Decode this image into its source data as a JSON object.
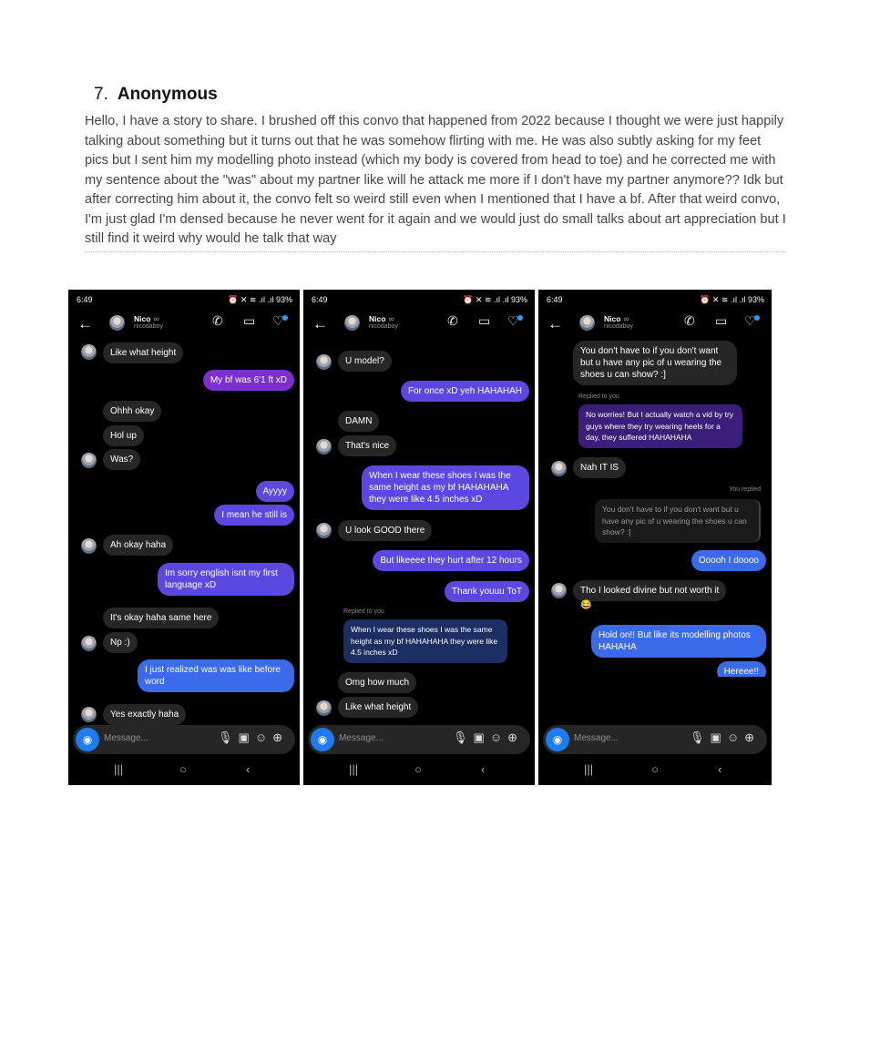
{
  "document": {
    "number": "7.",
    "title": "Anonymous",
    "body": "Hello, I have a story to share. I brushed off this convo that happened from 2022 because I thought we were just happily talking about something but it turns out that he was somehow flirting with me. He was also subtly asking for my feet pics but I sent him my modelling photo instead (which my body is covered from head to toe) and he corrected me with my sentence about the \"was\" about my partner like will he attack me more if I don't have my partner anymore?? Idk but after correcting him about it, the convo felt so weird still even when I mentioned that I have a bf. After that weird convo, I'm just glad I'm densed because he never went for it again and we would just do small talks about art appreciation but I still find it weird why would he talk that way"
  },
  "phone_common": {
    "time": "6:49",
    "status_icons": "⏰ ✕ ≋ .ıl .ıl 93%",
    "contact_name": "Nico",
    "contact_username": "nicodaboy",
    "composer_placeholder": "Message...",
    "icons": [
      "back-arrow-icon",
      "phone-icon",
      "video-icon",
      "heart-shield-icon",
      "camera-icon",
      "mic-icon",
      "gallery-icon",
      "sticker-icon",
      "plus-icon"
    ]
  },
  "screens": [
    {
      "messages": [
        {
          "dir": "in",
          "text": "Like what height"
        },
        {
          "dir": "out",
          "text": "My bf was 6'1 ft xD"
        },
        {
          "dir": "in",
          "text": "Ohhh okay"
        },
        {
          "dir": "in",
          "text": "Hol up"
        },
        {
          "dir": "in",
          "text": "Was?"
        },
        {
          "dir": "out",
          "text": "Ayyyy"
        },
        {
          "dir": "out",
          "text": "I mean he still is"
        },
        {
          "dir": "in",
          "text": "Ah okay haha"
        },
        {
          "dir": "out",
          "text": "Im sorry english isnt my first language xD"
        },
        {
          "dir": "in",
          "text": "It's okay haha same here"
        },
        {
          "dir": "in",
          "text": "Np :)"
        },
        {
          "dir": "out",
          "text": "I just realized was was like before word"
        },
        {
          "dir": "in",
          "text": "Yes exactly haha"
        }
      ]
    },
    {
      "messages": [
        {
          "dir": "in",
          "text": "U model?"
        },
        {
          "dir": "out",
          "text": "For once xD yeh HAHAHAH"
        },
        {
          "dir": "in",
          "text": "DAMN"
        },
        {
          "dir": "in",
          "text": "That's nice"
        },
        {
          "dir": "out",
          "text": "When I wear these shoes I was the same height as my bf HAHAHAHA they were like 4.5 inches xD"
        },
        {
          "dir": "in",
          "text": "U look GOOD there"
        },
        {
          "dir": "out",
          "text": "But likeeee they hurt after 12 hours"
        },
        {
          "dir": "out",
          "text": "Thank youuu ToT"
        },
        {
          "dir": "note",
          "text": "Replied to you"
        },
        {
          "dir": "reply",
          "text": "When I wear these shoes I was the same height as my bf HAHAHAHA they were like 4.5 inches xD"
        },
        {
          "dir": "in",
          "text": "Omg how much"
        },
        {
          "dir": "in",
          "text": "Like what height"
        }
      ]
    },
    {
      "messages": [
        {
          "dir": "in",
          "text": "You don't have to if you don't want but u have any pic of u wearing the shoes u can show? :]"
        },
        {
          "dir": "note",
          "text": "Replied to you"
        },
        {
          "dir": "reply",
          "text": "No worries! But I actually watch a vid by try guys where they try wearing heels for a day, they suffered HAHAHAHA"
        },
        {
          "dir": "in",
          "text": "Nah IT IS"
        },
        {
          "dir": "note",
          "text": "You replied"
        },
        {
          "dir": "quote",
          "text": "You don't have to if you don't want but u have any pic of u wearing the shoes u can show? :]"
        },
        {
          "dir": "out",
          "text": "Ooooh I doooo"
        },
        {
          "dir": "in",
          "text": "Tho I looked divine but not worth it"
        },
        {
          "dir": "reaction",
          "text": "😂"
        },
        {
          "dir": "out",
          "text": "Hold on!! But like its modelling photos HAHAHA"
        },
        {
          "dir": "out",
          "text": "Hereee!!"
        }
      ]
    }
  ]
}
